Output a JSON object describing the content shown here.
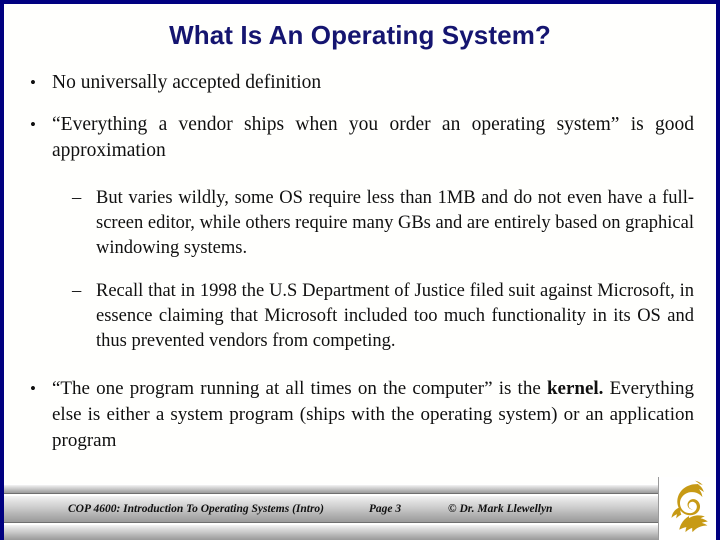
{
  "slide": {
    "title": "What Is An Operating System?",
    "title_color": "#151570",
    "border_color": "#000080",
    "background_color": "#fffffd",
    "bullets": [
      {
        "level": 1,
        "marker": "•",
        "text": "No universally accepted definition"
      },
      {
        "level": 1,
        "marker": "•",
        "text": "“Everything a vendor ships when you order an operating system” is good approximation"
      },
      {
        "level": 2,
        "marker": "–",
        "text": "But varies wildly, some OS require less than 1MB and do not even have a full-screen editor, while others require many GBs and are entirely based on graphical windowing systems."
      },
      {
        "level": 2,
        "marker": "–",
        "text": "Recall that in 1998 the U.S Department of Justice filed suit against Microsoft, in essence claiming that Microsoft included too much functionality in its OS and thus prevented vendors from competing."
      },
      {
        "level": 1,
        "marker": "•",
        "text_part_1": "“The one program running at all times on the computer” is the ",
        "text_bold": "kernel.",
        "text_part_2": " Everything else is either a system program (ships with the operating system) or an application program"
      }
    ]
  },
  "footer": {
    "course": "COP 4600: Introduction To Operating Systems (Intro)",
    "page": "Page 3",
    "copyright": "© Dr. Mark Llewellyn",
    "logo_name": "ucf-pegasus-logo",
    "logo_color": "#c79a15",
    "band_color": "#c9c9c9"
  }
}
